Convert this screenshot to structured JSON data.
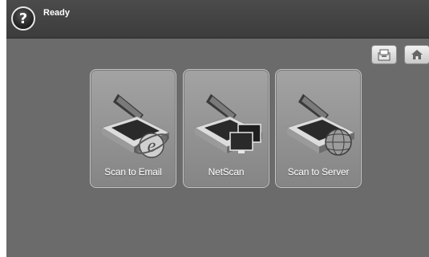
{
  "status": {
    "help_symbol": "?",
    "text": "Ready"
  },
  "toolbar": {
    "job_status_icon": "job-status-icon",
    "home_icon": "home-icon"
  },
  "tiles": [
    {
      "label": "Scan to Email",
      "icon": "scanner-internet-explorer-icon"
    },
    {
      "label": "NetScan",
      "icon": "scanner-monitors-icon"
    },
    {
      "label": "Scan to Server",
      "icon": "scanner-globe-icon"
    }
  ],
  "colors": {
    "screen_bg": "#6b6b6b",
    "status_bar": "#444444",
    "tile_bg": "#979797",
    "text": "#ffffff"
  }
}
